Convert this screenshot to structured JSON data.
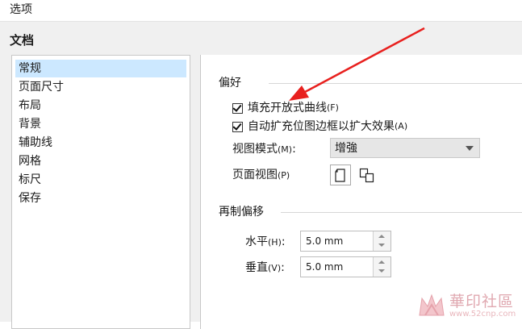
{
  "window": {
    "title": "选项"
  },
  "section": {
    "heading": "文档"
  },
  "sidebar": {
    "items": [
      {
        "label": "常规",
        "selected": true
      },
      {
        "label": "页面尺寸"
      },
      {
        "label": "布局"
      },
      {
        "label": "背景"
      },
      {
        "label": "辅助线"
      },
      {
        "label": "网格"
      },
      {
        "label": "标尺"
      },
      {
        "label": "保存"
      }
    ]
  },
  "preferences": {
    "group_title": "偏好",
    "fill_open_curves": {
      "label": "填充开放式曲线",
      "mnemonic": "(F)",
      "checked": true
    },
    "auto_inflate_bitmap": {
      "label": "自动扩充位图边框以扩大效果",
      "mnemonic": "(A)",
      "checked": true
    },
    "view_mode": {
      "label": "视图模式",
      "mnemonic": "(M)",
      "colon": ":",
      "value": "增強"
    },
    "page_view": {
      "label": "页面视图",
      "mnemonic": "(P)",
      "options": [
        "single-page-icon",
        "multi-page-icon"
      ],
      "selected": "single-page-icon"
    }
  },
  "duplicate_offset": {
    "group_title": "再制偏移",
    "horizontal": {
      "label": "水平",
      "mnemonic": "(H)",
      "colon": ":",
      "value": "5.0 mm"
    },
    "vertical": {
      "label": "垂直",
      "mnemonic": "(V)",
      "colon": ":",
      "value": "5.0 mm"
    }
  },
  "annotation": {
    "arrow_color": "#e8201e"
  },
  "watermark": {
    "text": "華印社區",
    "url": "www.52cnp.com"
  },
  "colors": {
    "selection": "#cce8ff",
    "dialog_bg": "#f0f0f0"
  }
}
